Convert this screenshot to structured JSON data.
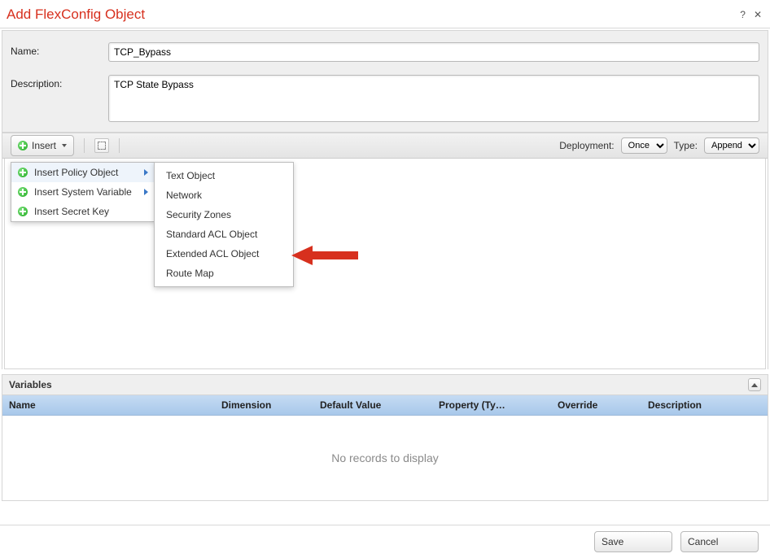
{
  "dialog": {
    "title": "Add FlexConfig Object"
  },
  "form": {
    "name_label": "Name:",
    "name_value": "TCP_Bypass",
    "desc_label": "Description:",
    "desc_value": "TCP State Bypass"
  },
  "toolbar": {
    "insert_label": "Insert",
    "deployment_label": "Deployment:",
    "deployment_value": "Once",
    "type_label": "Type:",
    "type_value": "Append"
  },
  "insert_menu": {
    "items": [
      {
        "label": "Insert Policy Object",
        "has_submenu": true,
        "hover": true
      },
      {
        "label": "Insert System Variable",
        "has_submenu": true,
        "hover": false
      },
      {
        "label": "Insert Secret Key",
        "has_submenu": false,
        "hover": false
      }
    ]
  },
  "policy_submenu": {
    "items": [
      {
        "label": "Text Object"
      },
      {
        "label": "Network"
      },
      {
        "label": "Security Zones"
      },
      {
        "label": "Standard ACL Object"
      },
      {
        "label": "Extended ACL Object"
      },
      {
        "label": "Route Map"
      }
    ]
  },
  "variables": {
    "panel_title": "Variables",
    "columns": {
      "name": "Name",
      "dimension": "Dimension",
      "default_value": "Default Value",
      "property": "Property (Ty…",
      "override": "Override",
      "description": "Description"
    },
    "empty_text": "No records to display"
  },
  "footer": {
    "save": "Save",
    "cancel": "Cancel"
  }
}
